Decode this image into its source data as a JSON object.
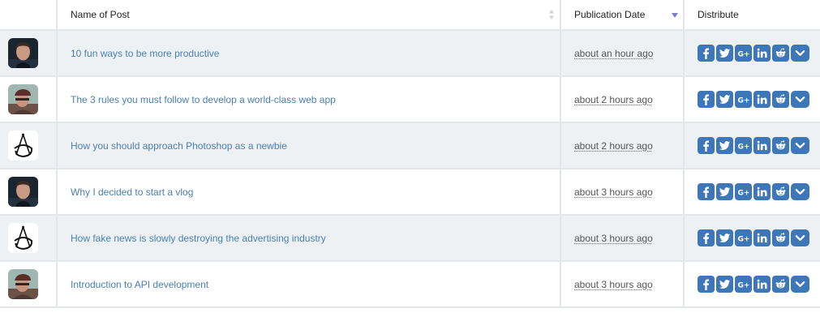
{
  "table": {
    "headers": {
      "name": "Name of Post",
      "date": "Publication Date",
      "distribute": "Distribute"
    },
    "rows": [
      {
        "avatar": "avatar-man-dark",
        "title": "10 fun ways to be more productive",
        "date": "about an hour ago"
      },
      {
        "avatar": "avatar-man-cap",
        "title": "The 3 rules you must follow to develop a world-class web app",
        "date": "about 2 hours ago"
      },
      {
        "avatar": "avatar-logo",
        "title": "How you should approach Photoshop as a newbie",
        "date": "about 2 hours ago"
      },
      {
        "avatar": "avatar-man-dark",
        "title": "Why I decided to start a vlog",
        "date": "about 3 hours ago"
      },
      {
        "avatar": "avatar-logo",
        "title": "How fake news is slowly destroying the advertising industry",
        "date": "about 3 hours ago"
      },
      {
        "avatar": "avatar-man-cap",
        "title": "Introduction to API development",
        "date": "about 3 hours ago"
      }
    ]
  },
  "share_icons": [
    "facebook-icon",
    "twitter-icon",
    "google-plus-icon",
    "linkedin-icon",
    "reddit-icon",
    "chevron-down-icon"
  ],
  "colors": {
    "share_button": "#3d77b7",
    "link": "#4a7fb0",
    "row_alt": "#eef1f4",
    "sort_active": "#7b7fc7"
  }
}
